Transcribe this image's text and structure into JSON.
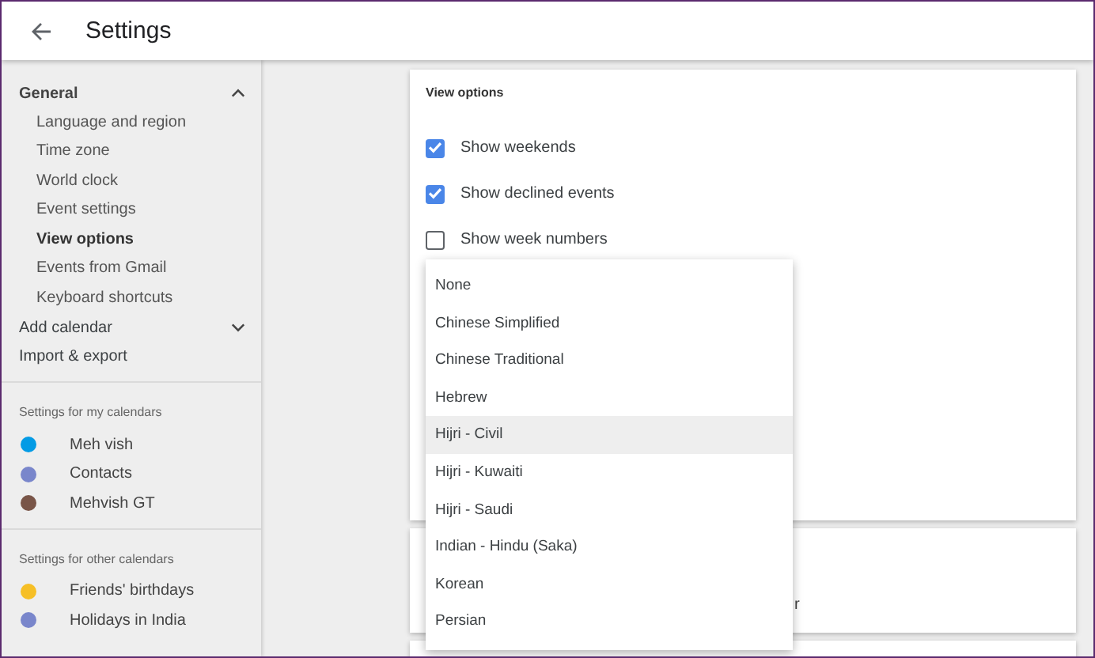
{
  "header": {
    "title": "Settings"
  },
  "sidebar": {
    "sections": [
      {
        "kind": "nav",
        "items": [
          {
            "label": "General",
            "expanded": true,
            "children": [
              {
                "label": "Language and region",
                "selected": false
              },
              {
                "label": "Time zone",
                "selected": false
              },
              {
                "label": "World clock",
                "selected": false
              },
              {
                "label": "Event settings",
                "selected": false
              },
              {
                "label": "View options",
                "selected": true
              },
              {
                "label": "Events from Gmail",
                "selected": false
              },
              {
                "label": "Keyboard shortcuts",
                "selected": false
              }
            ]
          },
          {
            "label": "Add calendar",
            "expanded": false
          },
          {
            "label": "Import & export"
          }
        ]
      },
      {
        "kind": "calendars",
        "title": "Settings for my calendars",
        "items": [
          {
            "label": "Meh vish",
            "color": "#039be5"
          },
          {
            "label": "Contacts",
            "color": "#7986cb"
          },
          {
            "label": "Mehvish GT",
            "color": "#795548"
          }
        ]
      },
      {
        "kind": "calendars",
        "title": "Settings for other calendars",
        "items": [
          {
            "label": "Friends' birthdays",
            "color": "#f6bf26"
          },
          {
            "label": "Holidays in India",
            "color": "#7986cb"
          }
        ]
      }
    ]
  },
  "view_options": {
    "title": "View options",
    "options": [
      {
        "label": "Show weekends",
        "checked": true
      },
      {
        "label": "Show declined events",
        "checked": true
      },
      {
        "label": "Show week numbers",
        "checked": false
      }
    ]
  },
  "alternate_calendar_menu": [
    {
      "label": "None",
      "selected": false
    },
    {
      "label": "Chinese Simplified",
      "selected": false
    },
    {
      "label": "Chinese Traditional",
      "selected": false
    },
    {
      "label": "Hebrew",
      "selected": false
    },
    {
      "label": "Hijri - Civil",
      "selected": true
    },
    {
      "label": "Hijri - Kuwaiti",
      "selected": false
    },
    {
      "label": "Hijri - Saudi",
      "selected": false
    },
    {
      "label": "Indian - Hindu (Saka)",
      "selected": false
    },
    {
      "label": "Korean",
      "selected": false
    },
    {
      "label": "Persian",
      "selected": false
    }
  ],
  "second_card": {
    "text_fragment": "r"
  }
}
